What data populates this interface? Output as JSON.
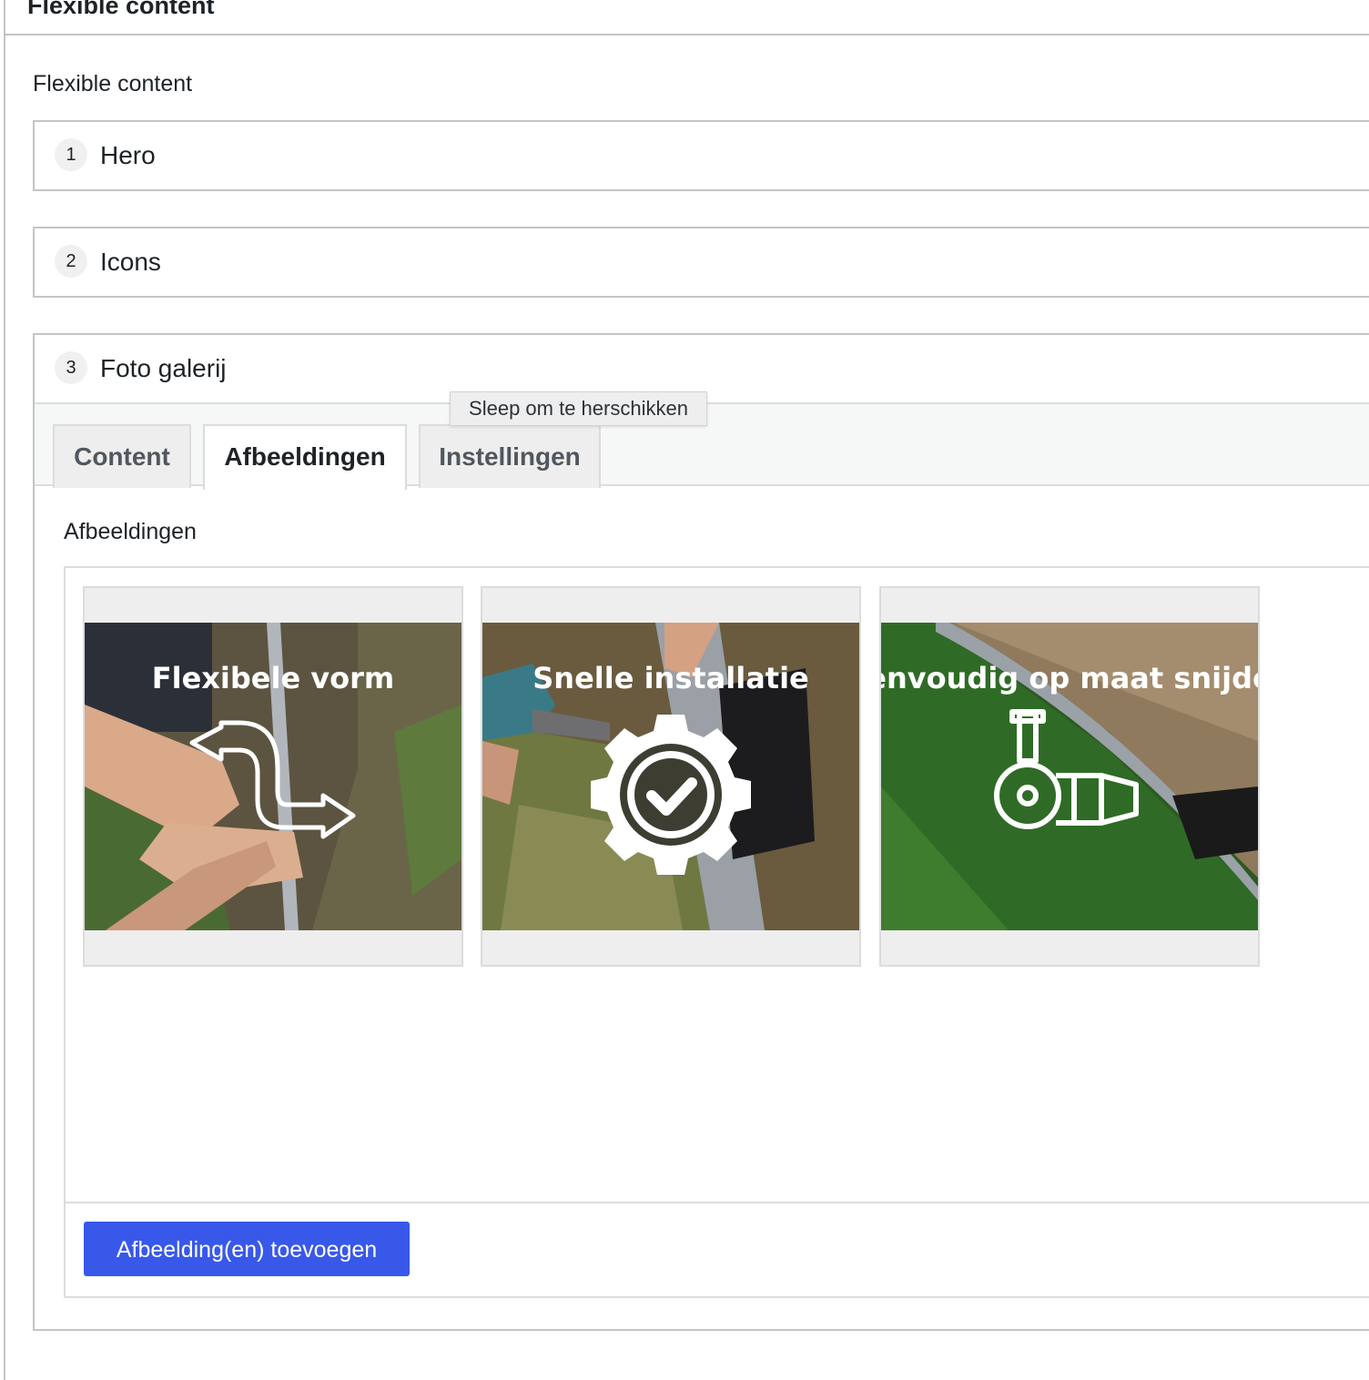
{
  "metabox": {
    "title": "Flexible content"
  },
  "field": {
    "label": "Flexible content"
  },
  "layouts": [
    {
      "order": "1",
      "name": "Hero"
    },
    {
      "order": "2",
      "name": "Icons"
    },
    {
      "order": "3",
      "name": "Foto galerij"
    }
  ],
  "tabs": [
    {
      "label": "Content",
      "active": false
    },
    {
      "label": "Afbeeldingen",
      "active": true
    },
    {
      "label": "Instellingen",
      "active": false
    }
  ],
  "tooltip": "Sleep om te herschikken",
  "gallery": {
    "label": "Afbeeldingen",
    "images": [
      {
        "caption": "Flexibele vorm",
        "icon": "curved-arrows-icon"
      },
      {
        "caption": "Snelle installatie",
        "icon": "gear-check-icon"
      },
      {
        "caption": "envoudig op maat snijde",
        "icon": "angle-grinder-icon"
      }
    ],
    "add_button": "Afbeelding(en) toevoegen"
  },
  "colors": {
    "primary_button": "#3858e9",
    "border": "#c3c4c7",
    "tab_bar": "#f6f7f7"
  }
}
